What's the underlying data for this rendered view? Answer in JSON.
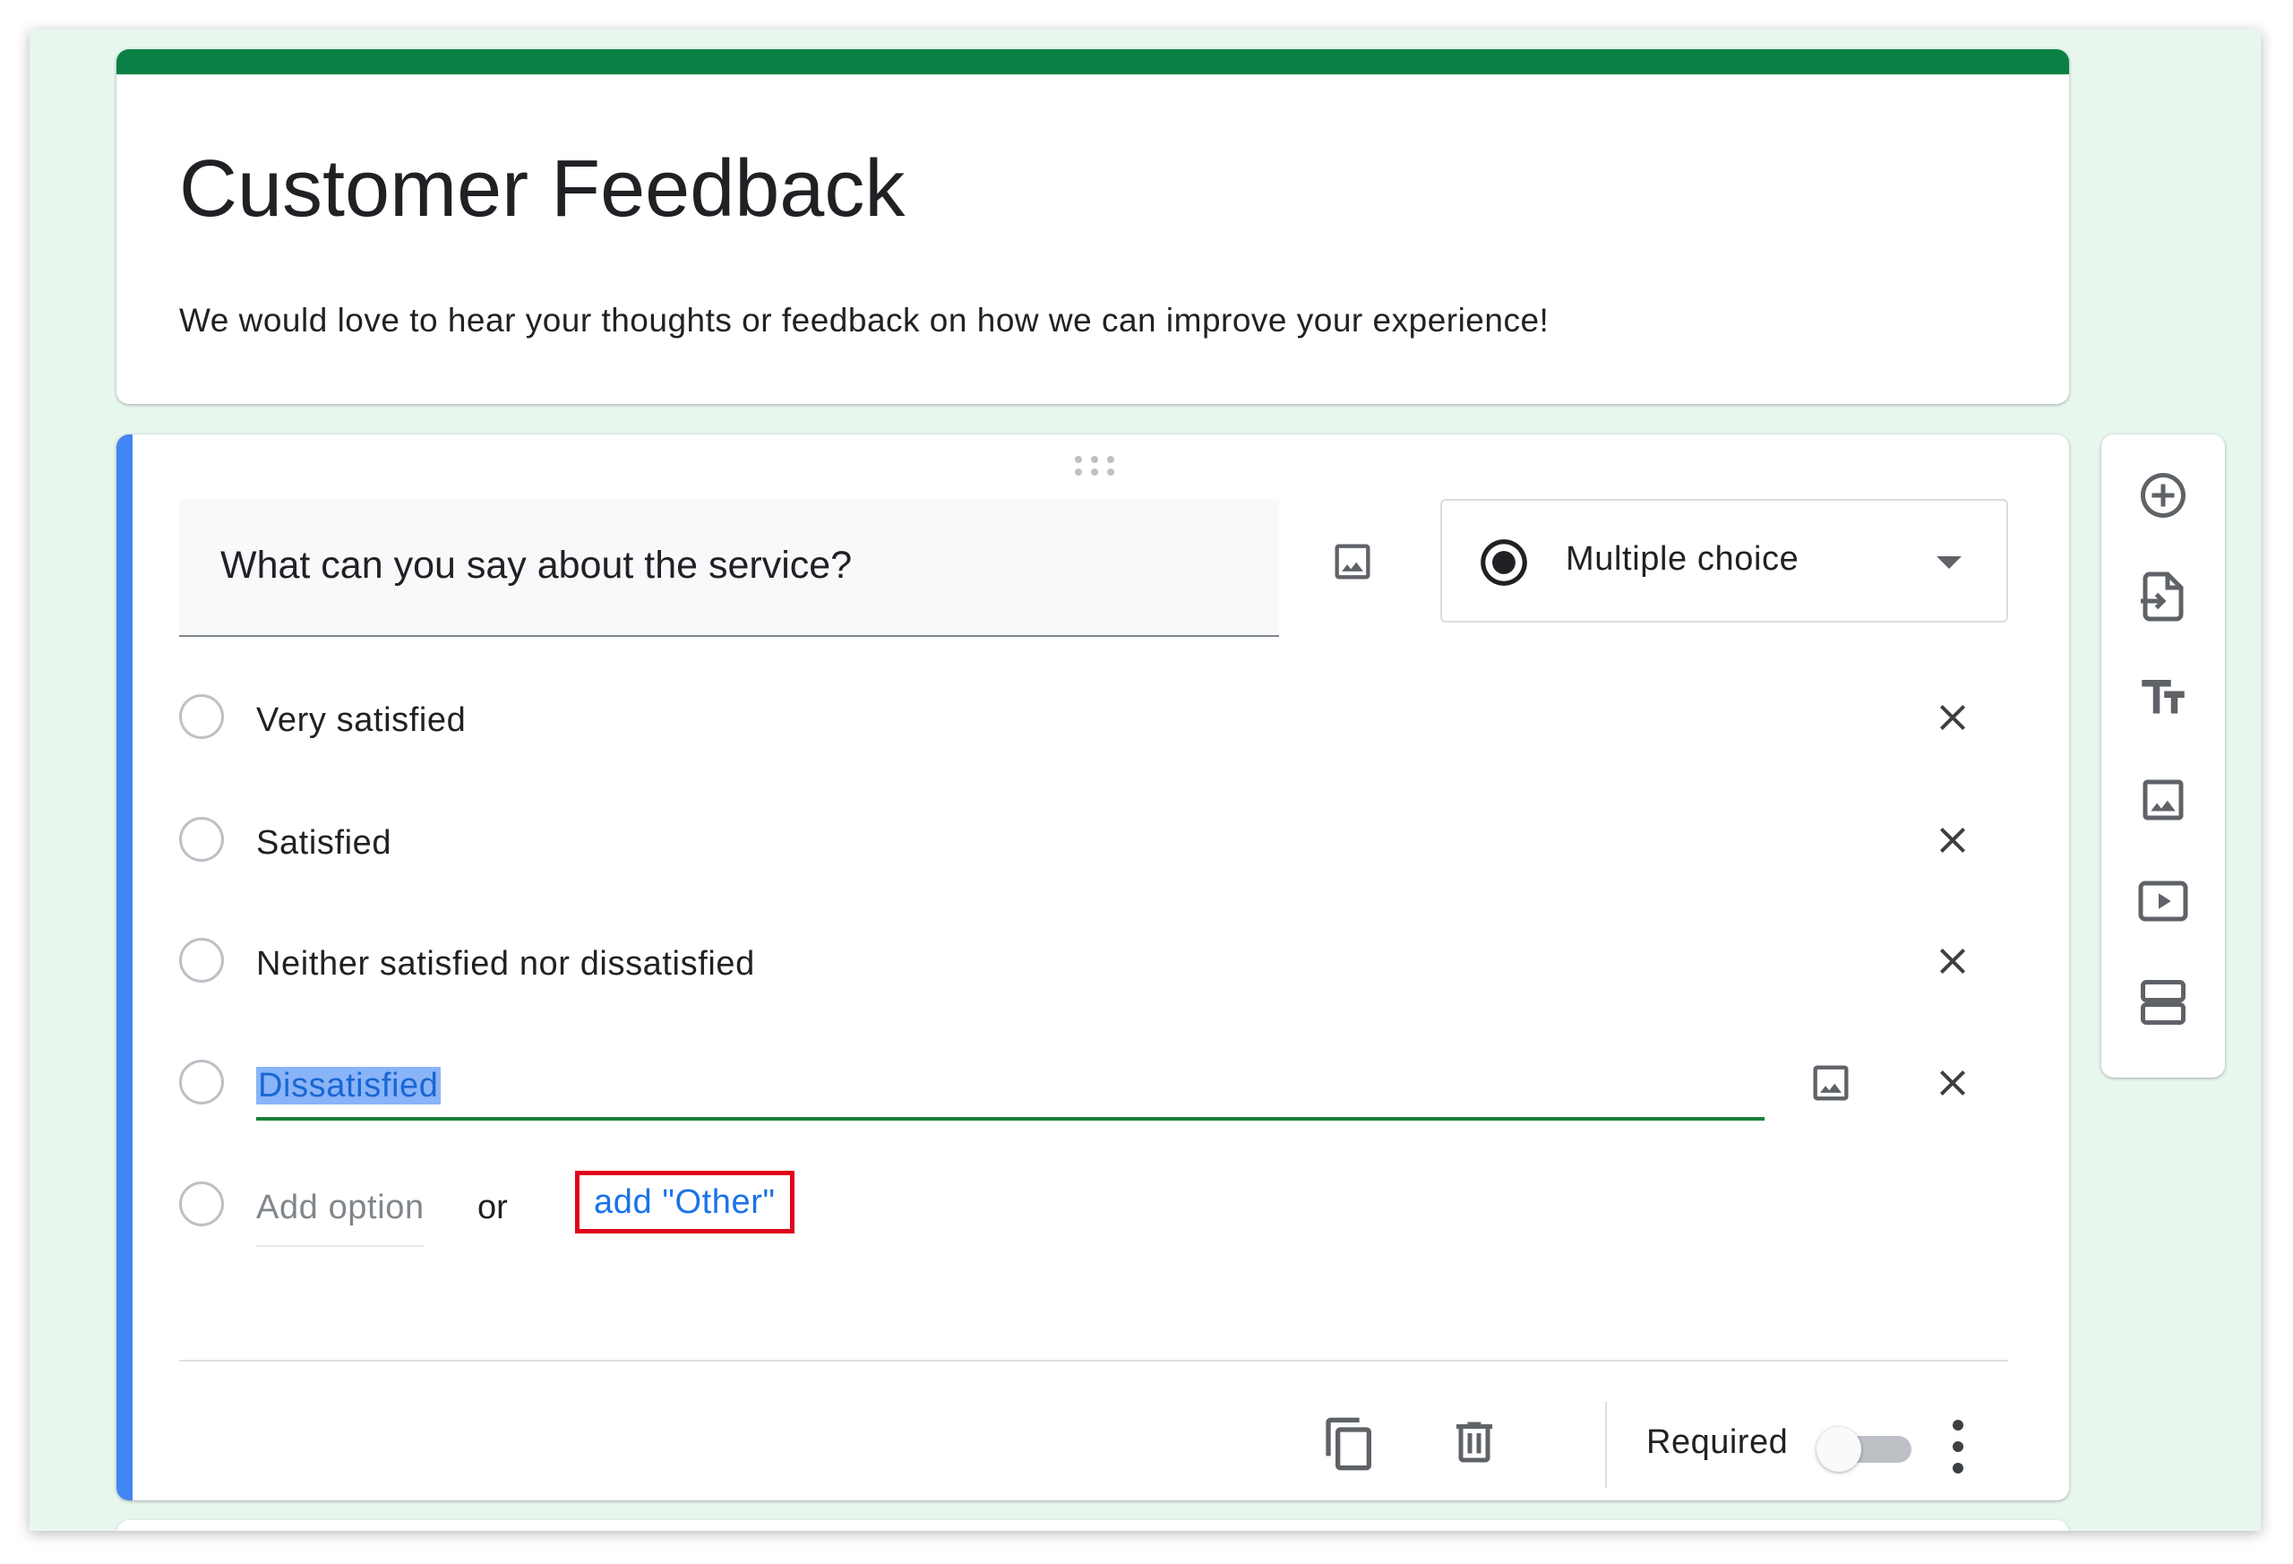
{
  "form": {
    "title": "Customer Feedback",
    "description": "We would love to hear your thoughts or feedback on how we can improve your experience!"
  },
  "question": {
    "text": "What can you say about the service?",
    "type_label": "Multiple choice",
    "options": [
      {
        "label": "Very satisfied"
      },
      {
        "label": "Satisfied"
      },
      {
        "label": "Neither satisfied nor dissatisfied"
      },
      {
        "label": "Dissatisfied",
        "editing": true,
        "text_selected": true
      }
    ],
    "add_option_placeholder": "Add option",
    "or_label": "or",
    "add_other_label": "add \"Other\"",
    "required_label": "Required",
    "required": false
  },
  "icons": {
    "drag": "drag-handle-icon",
    "image": "image-icon",
    "radio": "radio-checked-icon",
    "dropdown": "arrow-drop-down-icon",
    "remove": "close-icon",
    "copy": "content-copy-icon",
    "delete": "trash-icon",
    "more": "more-vert-icon"
  },
  "toolbar": [
    "add-question-icon",
    "import-questions-icon",
    "title-text-icon",
    "image-icon",
    "video-icon",
    "section-icon"
  ],
  "colors": {
    "header_bar": "#0a8044",
    "active_accent": "#4285f4",
    "edit_underline": "#188038",
    "link": "#1a73e8",
    "highlight_box": "#e0001b",
    "background": "#e8f7ee"
  }
}
